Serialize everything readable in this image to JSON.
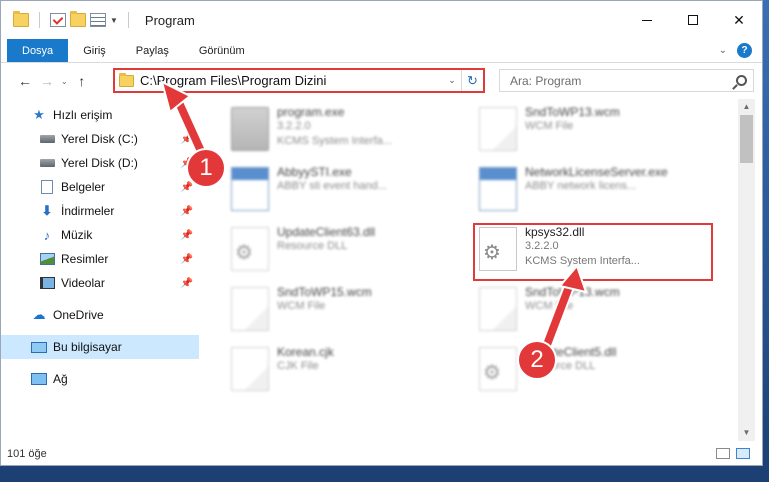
{
  "window": {
    "title": "Program"
  },
  "ribbon": {
    "tabs": [
      "Dosya",
      "Giriş",
      "Paylaş",
      "Görünüm"
    ]
  },
  "address": {
    "path": "C:\\Program Files\\Program Dizini"
  },
  "search": {
    "placeholder": "Ara: Program"
  },
  "sidebar": {
    "items": [
      {
        "label": "Hızlı erişim",
        "icon": "star-icon"
      },
      {
        "label": "Yerel Disk (C:)",
        "icon": "disk-icon"
      },
      {
        "label": "Yerel Disk (D:)",
        "icon": "disk-icon"
      },
      {
        "label": "Belgeler",
        "icon": "documents-icon"
      },
      {
        "label": "İndirmeler",
        "icon": "downloads-icon"
      },
      {
        "label": "Müzik",
        "icon": "music-icon"
      },
      {
        "label": "Resimler",
        "icon": "pictures-icon"
      },
      {
        "label": "Videolar",
        "icon": "videos-icon"
      },
      {
        "label": "OneDrive",
        "icon": "cloud-icon"
      },
      {
        "label": "Bu bilgisayar",
        "icon": "computer-icon"
      },
      {
        "label": "Ağ",
        "icon": "network-icon"
      }
    ]
  },
  "files": [
    {
      "name": "program.exe",
      "line1": "3.2.2.0",
      "line2": "KCMS System Interfa..."
    },
    {
      "name": "SndToWP13.wcm",
      "line1": "WCM File",
      "line2": ""
    },
    {
      "name": "AbbyySTI.exe",
      "line1": "ABBY sti event hand...",
      "line2": ""
    },
    {
      "name": "NetworkLicenseServer.exe",
      "line1": "ABBY network licens...",
      "line2": ""
    },
    {
      "name": "UpdateClient63.dll",
      "line1": "Resource DLL",
      "line2": ""
    },
    {
      "name": "kpsys32.dll",
      "line1": "3.2.2.0",
      "line2": "KCMS System Interfa..."
    },
    {
      "name": "SndToWP15.wcm",
      "line1": "WCM File",
      "line2": ""
    },
    {
      "name": "SndToWP13.wcm",
      "line1": "WCM File",
      "line2": ""
    },
    {
      "name": "Korean.cjk",
      "line1": "CJK File",
      "line2": ""
    },
    {
      "name": "UpdateClient5.dll",
      "line1": "Resource DLL",
      "line2": ""
    }
  ],
  "status": {
    "count": "101 öğe"
  },
  "callouts": {
    "one": "1",
    "two": "2"
  },
  "colors": {
    "accent": "#1979ca",
    "highlight": "#e03a3a",
    "selected": "#cce8ff"
  }
}
